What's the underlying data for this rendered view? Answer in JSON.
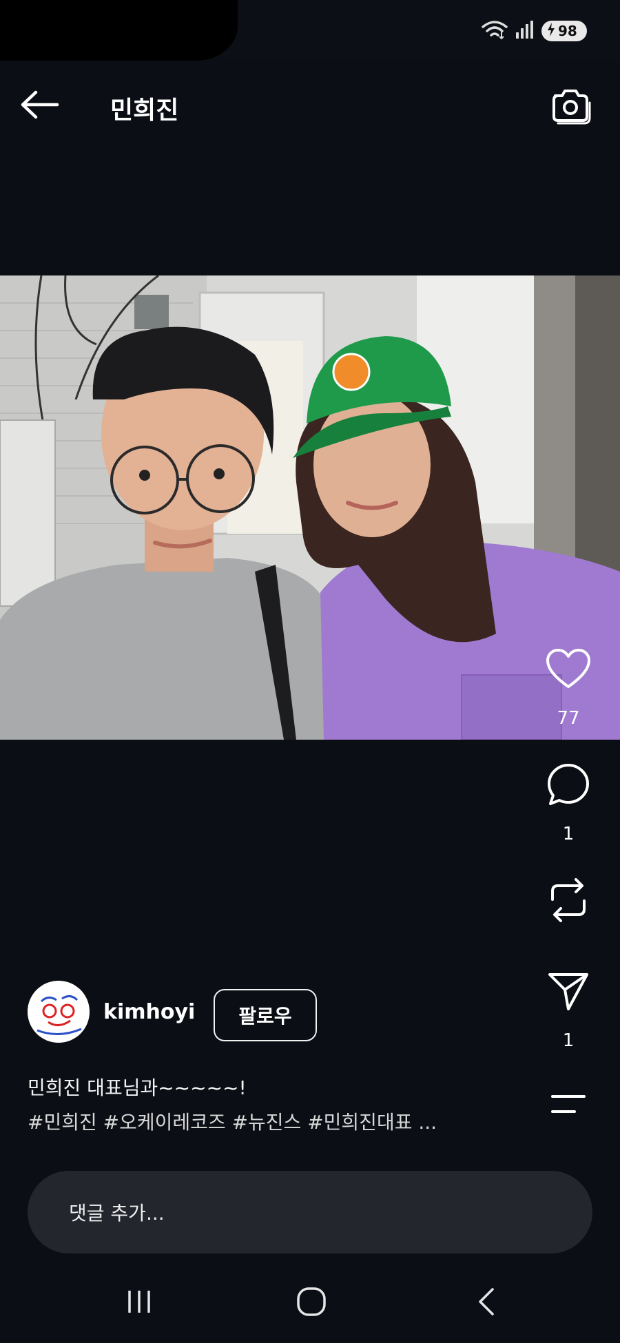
{
  "status_bar": {
    "battery_level": "98",
    "icons": [
      "wifi-icon",
      "signal-icon",
      "battery-charging-icon"
    ]
  },
  "header": {
    "title": "민희진",
    "icons": [
      "back-arrow-icon",
      "camera-icon"
    ]
  },
  "post": {
    "likes": "77",
    "comments": "1",
    "shares": "1",
    "rail_icons": [
      "heart-icon",
      "comment-bubble-icon",
      "repost-icon",
      "send-icon",
      "menu-lines-icon"
    ]
  },
  "author": {
    "username": "kimhoyi",
    "follow_label": "팔로우"
  },
  "caption": {
    "text": "민희진 대표님과~~~~~!",
    "hashtags": "#민희진 #오케이레코즈 #뉴진스 #민희진대표",
    "more": "..."
  },
  "comment_input": {
    "placeholder": "댓글 추가..."
  },
  "nav_bar": {
    "icons": [
      "recent-apps-icon",
      "home-icon",
      "back-icon"
    ]
  },
  "colors": {
    "background": "#0b0e14",
    "input_background": "#23262d",
    "text": "#f2f2f2"
  }
}
